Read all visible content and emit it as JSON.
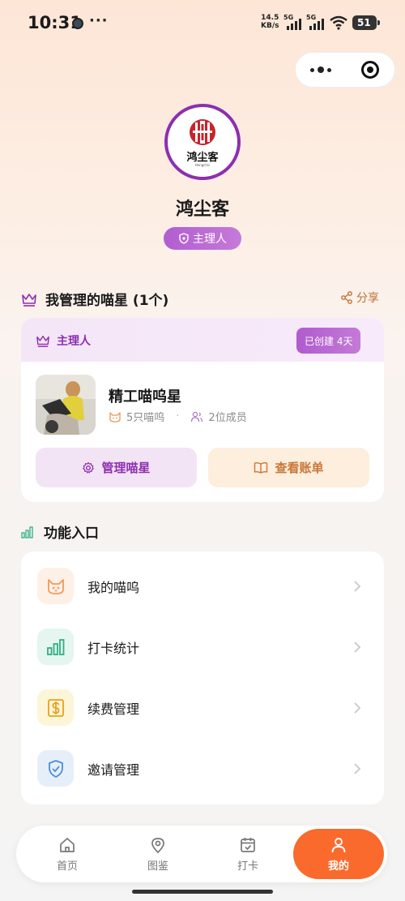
{
  "status_bar": {
    "time": "10:31",
    "more": "···",
    "net_speed_value": "14.5",
    "net_speed_unit": "KB/s",
    "signal1": "5G",
    "signal2": "5G",
    "battery": "51"
  },
  "profile": {
    "logo_text": "鸿尘客",
    "logo_sub": "Hongchic",
    "name": "鸿尘客",
    "role": "主理人"
  },
  "my_cats": {
    "title": "我管理的喵星 (1个)",
    "share": "分享",
    "owner_label": "主理人",
    "created_badge": "已创建 4天",
    "planet_name": "精工喵呜星",
    "cats_count": "5只喵呜",
    "members_count": "2位成员",
    "manage_button": "管理喵星",
    "bill_button": "查看账单"
  },
  "features": {
    "title": "功能入口",
    "items": [
      {
        "label": "我的喵呜",
        "icon": "cat-face-icon",
        "color": "#f5a36b",
        "bg": "#fdf0e6"
      },
      {
        "label": "打卡统计",
        "icon": "bar-chart-icon",
        "color": "#2fae84",
        "bg": "#e4f6ef"
      },
      {
        "label": "续费管理",
        "icon": "dollar-icon",
        "color": "#e7a21c",
        "bg": "#fdf5d8"
      },
      {
        "label": "邀请管理",
        "icon": "shield-check-icon",
        "color": "#4a8fd8",
        "bg": "#e6eff9"
      }
    ]
  },
  "tab_bar": {
    "tabs": [
      "首页",
      "图鉴",
      "打卡",
      "我的"
    ],
    "active": "我的",
    "accent": "#fa6a2c"
  }
}
